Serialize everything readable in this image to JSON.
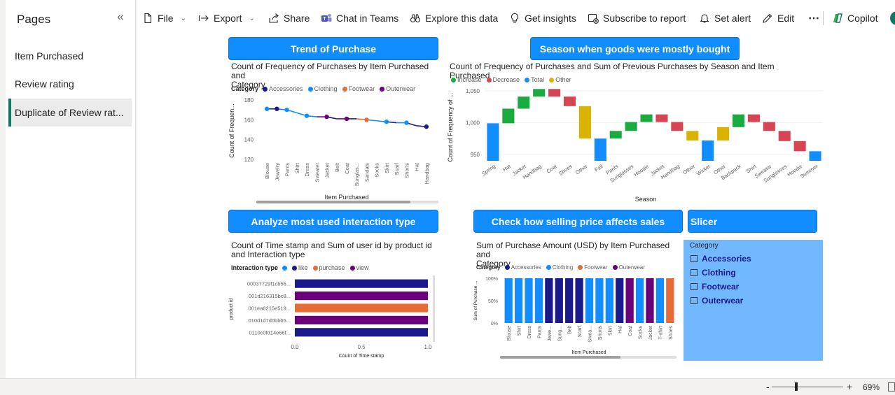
{
  "pages_pane": {
    "title": "Pages",
    "collapse_icon": "chevrons-left-icon",
    "items": [
      {
        "label": "Item Purchased"
      },
      {
        "label": "Review rating"
      },
      {
        "label": "Duplicate of Review rat..."
      }
    ]
  },
  "toolbar": {
    "file": "File",
    "export": "Export",
    "share": "Share",
    "chat": "Chat in Teams",
    "explore": "Explore this data",
    "insights": "Get insights",
    "subscribe": "Subscribe to report",
    "alert": "Set alert",
    "edit": "Edit",
    "more": "⋯",
    "copilot": "Copilot"
  },
  "headers": {
    "trend": "Trend of Purchase",
    "season": "Season when goods were mostly bought",
    "interaction": "Analyze most used interaction type",
    "price": "Check how selling price affects sales",
    "slicer": "Slicer"
  },
  "colors": {
    "accessories": "#1a1a8c",
    "clothing": "#118dff",
    "footwear": "#e66c37",
    "outerwear": "#6b007b",
    "increase": "#1aab40",
    "decrease": "#d64554",
    "total": "#118dff",
    "other": "#d9b300",
    "header_blue": "#118dff",
    "slicer_bg": "#72b8ff"
  },
  "chart_data": [
    {
      "type": "line",
      "title_line1": "Count of Frequency of Purchases by Item Purchased and",
      "title_line2": "Category",
      "legend_title": "Category",
      "legend": [
        "Accessories",
        "Clothing",
        "Footwear",
        "Outerwear"
      ],
      "xlabel": "Item Purchased",
      "ylabel": "Count of Frequen...",
      "ylim": [
        120,
        180
      ],
      "yticks": [
        "180",
        "160",
        "140",
        "120"
      ],
      "categories": [
        "Blouse",
        "Jewelry",
        "Pants",
        "Shirt",
        "Dress",
        "Sweater",
        "Jacket",
        "Belt",
        "Coat",
        "Sunglas...",
        "Sandals",
        "Socks",
        "Skirt",
        "Scarf",
        "Shorts",
        "Hat",
        "Handbag"
      ],
      "values": [
        171,
        171,
        170,
        167,
        164,
        163,
        163,
        161,
        161,
        161,
        160,
        159,
        158,
        157,
        157,
        154,
        153
      ],
      "series_index": [
        1,
        0,
        1,
        1,
        1,
        1,
        3,
        0,
        3,
        0,
        2,
        1,
        1,
        0,
        1,
        0,
        0
      ]
    },
    {
      "type": "waterfall",
      "title": "Count of Frequency of Purchases and Sum of Previous Purchases by Season and Item Purchased",
      "legend": [
        "Increase",
        "Decrease",
        "Total",
        "Other"
      ],
      "xlabel": "Season",
      "ylabel": "Count of Frequency of ...",
      "ylim": [
        940,
        1050
      ],
      "yticks": [
        "1,050",
        "1,000",
        "950"
      ],
      "categories": [
        "Spring",
        "Hat",
        "Jacket",
        "Handbag",
        "Coat",
        "Shoes",
        "Other",
        "Fall",
        "Pants",
        "Sunglasses",
        "Hoodie",
        "Jacket",
        "Handbag",
        "Other",
        "Winter",
        "Other",
        "Backpack",
        "Shirt",
        "Sweater",
        "Sunglasses",
        "Hoodie",
        "Summer"
      ],
      "kinds": [
        "total",
        "increase",
        "increase",
        "increase",
        "decrease",
        "decrease",
        "other",
        "total",
        "increase",
        "increase",
        "increase",
        "decrease",
        "decrease",
        "other",
        "total",
        "other",
        "increase",
        "decrease",
        "decrease",
        "decrease",
        "decrease",
        "total"
      ],
      "starts": [
        940,
        999,
        1022,
        1041,
        1053,
        1041,
        1026,
        940,
        975,
        987,
        1001,
        1013,
        1001,
        987,
        940,
        972,
        993,
        1013,
        1001,
        987,
        971,
        940
      ],
      "ends": [
        999,
        1022,
        1041,
        1053,
        1041,
        1026,
        975,
        975,
        987,
        1001,
        1013,
        1001,
        987,
        972,
        972,
        993,
        1013,
        1001,
        987,
        971,
        955,
        955
      ]
    },
    {
      "type": "bar",
      "orientation": "horizontal",
      "title_line1": "Count of Time stamp and Sum of user id by product id",
      "title_line2": "and Interaction type",
      "legend_title": "Interaction type",
      "legend": [
        "",
        "like",
        "purchase",
        "view"
      ],
      "legend_colors": [
        "#118dff",
        "#1a1a8c",
        "#e66c37",
        "#6b007b"
      ],
      "xlabel": "Count of Time stamp",
      "ylabel": "product id",
      "xlim": [
        0,
        1
      ],
      "xticks": [
        "0.0",
        "0.5",
        "1.0"
      ],
      "categories": [
        "00037729f1cb56...",
        "001d216315bc8...",
        "001ea8215e519...",
        "010d1d7d0bbb5...",
        "0110c0fd14e66f..."
      ],
      "values": [
        1,
        1,
        1,
        1,
        1
      ],
      "bar_colors": [
        "#1a1a8c",
        "#6b007b",
        "#e66c37",
        "#6b007b",
        "#1a1a8c"
      ]
    },
    {
      "type": "bar",
      "orientation": "vertical",
      "stacked_percent": true,
      "title_line1": "Sum of Purchase Amount (USD) by Item Purchased and",
      "title_line2": "Category",
      "legend_title": "Category",
      "legend": [
        "Accessories",
        "Clothing",
        "Footwear",
        "Outerwear"
      ],
      "xlabel": "Item Purchased",
      "ylabel": "Sum of Purchase ...",
      "ylim": [
        0,
        100
      ],
      "yticks": [
        "100%",
        "50%",
        "0%"
      ],
      "categories": [
        "Blouse",
        "Shirt",
        "Dress",
        "Pants",
        "Jewe...",
        "Sung...",
        "Belt",
        "Scarf",
        "Swea...",
        "Shorts",
        "Skirt",
        "Hat",
        "Coat",
        "Socks",
        "Jacket",
        "T-shirt",
        "Shoes"
      ],
      "values": [
        100,
        100,
        100,
        100,
        100,
        100,
        100,
        100,
        100,
        100,
        100,
        100,
        100,
        100,
        100,
        100,
        100
      ],
      "bar_colors": [
        "#118dff",
        "#118dff",
        "#118dff",
        "#118dff",
        "#1a1a8c",
        "#1a1a8c",
        "#1a1a8c",
        "#1a1a8c",
        "#118dff",
        "#118dff",
        "#118dff",
        "#1a1a8c",
        "#6b007b",
        "#118dff",
        "#6b007b",
        "#118dff",
        "#e66c37"
      ]
    }
  ],
  "slicer": {
    "field": "Category",
    "options": [
      "Accessories",
      "Clothing",
      "Footwear",
      "Outerwear"
    ]
  },
  "status": {
    "zoom_minus": "-",
    "zoom_plus": "+",
    "zoom": "69%",
    "zoom_level_percent": 69
  }
}
